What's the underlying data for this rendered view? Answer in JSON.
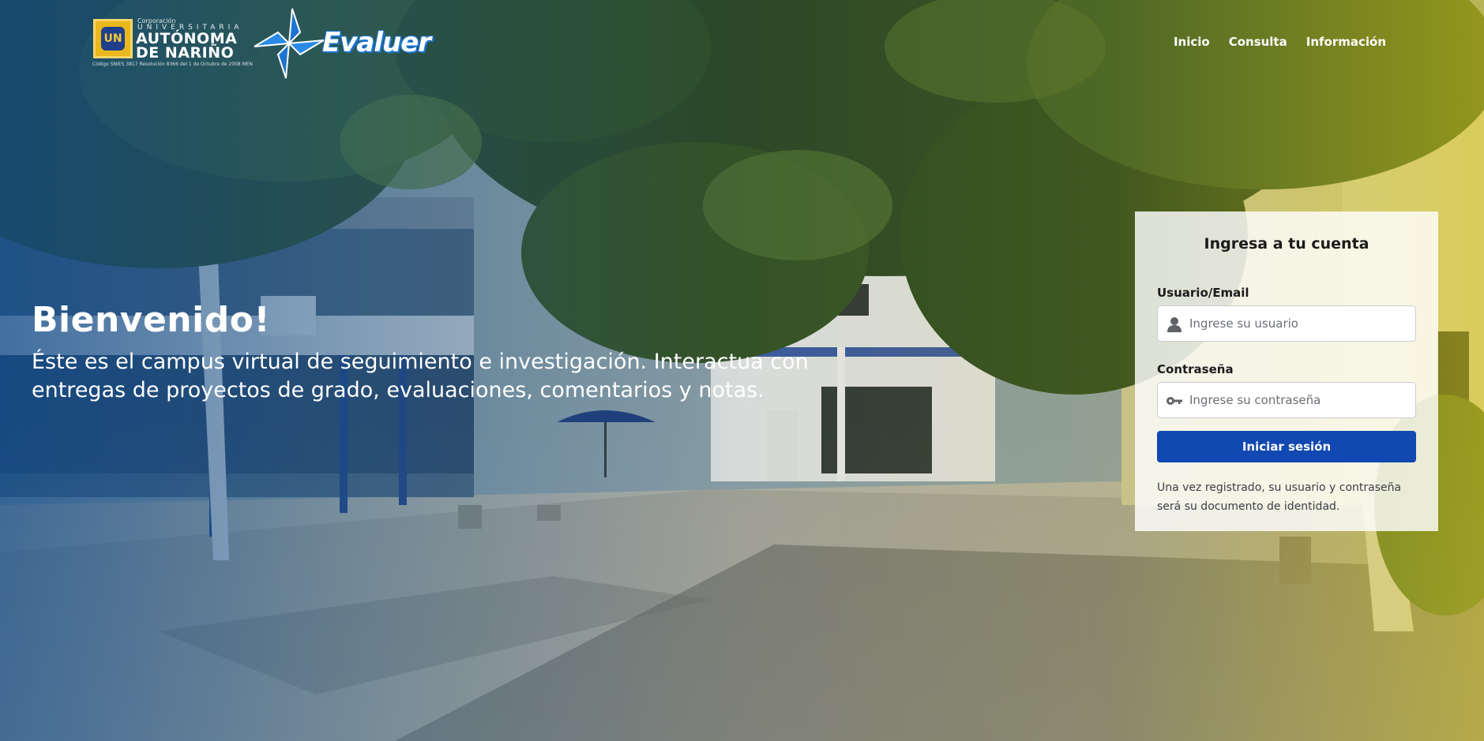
{
  "university": {
    "caption_top": "Corporación",
    "caption_mid": "UNIVERSITARIA",
    "name_line1": "AUTÓNOMA",
    "name_line2": "DE NARIÑO",
    "seal_text": "UN",
    "code": "Código SNIES 3817 Resolución 8366 del 1 de Octubre de 2008 MEN"
  },
  "brand": {
    "name": "Evaluer"
  },
  "nav": [
    {
      "label": "Inicio"
    },
    {
      "label": "Consulta"
    },
    {
      "label": "Información"
    }
  ],
  "hero": {
    "title": "Bienvenido!",
    "text": "Éste es el campus virtual de seguimiento e investigación. Interactua con entregas de proyectos de grado, evaluaciones, comentarios y notas."
  },
  "login": {
    "title": "Ingresa a tu cuenta",
    "user_label": "Usuario/Email",
    "user_placeholder": "Ingrese su usuario",
    "user_icon": "user-icon",
    "password_label": "Contraseña",
    "password_placeholder": "Ingrese su contraseña",
    "password_icon": "key-icon",
    "submit_label": "Iniciar sesión",
    "note": "Una vez registrado, su usuario y contraseña será su documento de identidad."
  },
  "colors": {
    "primary_button": "#1148b1",
    "overlay_left": "#0e4a8c",
    "overlay_right": "#dac416",
    "seal": "#e9b81c"
  }
}
